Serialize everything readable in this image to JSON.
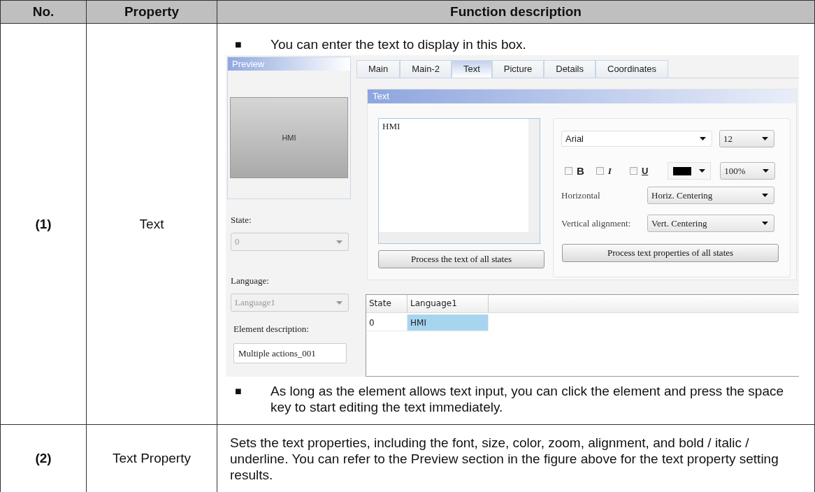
{
  "table": {
    "columns": [
      "No.",
      "Property",
      "Function description"
    ],
    "rows": [
      {
        "kind": "figure",
        "no": "(1)",
        "property": "Text",
        "notes": [
          {
            "marker": "■",
            "text": "You can enter the text to display in this box."
          },
          {
            "marker": "■",
            "text": "As long as the element allows text input, you can click the element and press the space key to start editing the text immediately."
          }
        ],
        "figure": {
          "preview": {
            "title": "Preview",
            "sample": "HMI"
          },
          "state": {
            "label": "State:",
            "value": "0",
            "disabled": true
          },
          "language": {
            "label": "Language:",
            "value": "Language1",
            "disabled": true
          },
          "element_description": {
            "label": "Element description:",
            "value": "Multiple actions_001"
          },
          "tabs": [
            {
              "label": "Main",
              "selected": false
            },
            {
              "label": "Main-2",
              "selected": false
            },
            {
              "label": "Text",
              "selected": true
            },
            {
              "label": "Picture",
              "selected": false
            },
            {
              "label": "Details",
              "selected": false
            },
            {
              "label": "Coordinates",
              "selected": false
            }
          ],
          "group_title": "Text",
          "text_box": {
            "value": "HMI"
          },
          "process_text_button": "Process the text of all states",
          "font": {
            "value": "Arial"
          },
          "size": {
            "value": "12"
          },
          "styles": [
            {
              "kind": "bold",
              "label": "B",
              "checked": false
            },
            {
              "kind": "italic",
              "label": "I",
              "checked": false
            },
            {
              "kind": "underline",
              "label": "U",
              "checked": false
            }
          ],
          "text_color": {
            "color": "#000000"
          },
          "zoom": {
            "value": "100%"
          },
          "horizontal": {
            "label": "Horizontal",
            "value": "Horiz. Centering"
          },
          "vertical": {
            "label": "Vertical alignment:",
            "value": "Vert. Centering"
          },
          "process_properties_button": "Process text properties of all states",
          "grid": {
            "columns": [
              "State",
              "Language1"
            ],
            "rows": [
              {
                "cells": [
                  {
                    "text": "0",
                    "selected": false
                  },
                  {
                    "text": "HMI",
                    "selected": true
                  }
                ]
              }
            ]
          }
        }
      },
      {
        "kind": "plain",
        "no": "(2)",
        "property": "Text Property",
        "description": "Sets the text properties, including the font, size, color, zoom, alignment, and bold / italic / underline. You can refer to the Preview section in the figure above for the text property setting results."
      }
    ]
  }
}
